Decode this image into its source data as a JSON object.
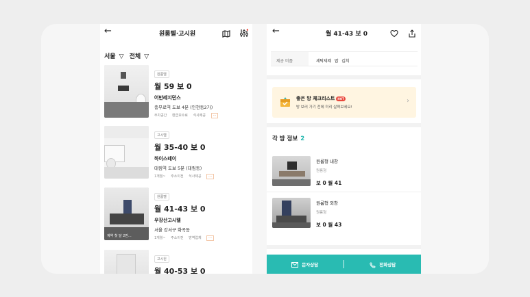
{
  "left": {
    "title": "원룸텔·고시원",
    "filters": {
      "region": "서울",
      "type": "전체"
    },
    "listings": [
      {
        "badge": "원룸텔",
        "price": "월 59  보 0",
        "name": "어반레지던스",
        "location": "충무로역 도보 4분 (인현동2가)",
        "tags": [
          "주차공간",
          "환급보수료",
          "식사제공"
        ],
        "overlay": ""
      },
      {
        "badge": "고시텔",
        "price": "월 35-40  보 0",
        "name": "하이스테이",
        "location": "대림역 도보 5분 (대림동)",
        "tags": [
          "1개월~",
          "주소이전",
          "식사제공"
        ],
        "overlay": ""
      },
      {
        "badge": "원룸텔",
        "price": "월 41-43  보 0",
        "name": "우장산고시텔",
        "location": "서울 강서구 화곡동",
        "tags": [
          "1개월~",
          "주소이전",
          "방역업체"
        ],
        "overlay": "계약 첫 달 2만..."
      },
      {
        "badge": "고시원",
        "price": "월 40-53  보 0",
        "name": "",
        "location": "",
        "tags": [],
        "overlay": ""
      }
    ]
  },
  "right": {
    "title": "월 41-43  보 0",
    "provide": {
      "label": "제공 비품",
      "items": "세탁세제  밥  김치"
    },
    "checklist": {
      "title": "좋은 방 체크리스트",
      "hot": "HOT",
      "subtitle": "방 보러 가기 전에 미리 살펴보세요!"
    },
    "rooms_header": {
      "label": "각 방 정보",
      "count": "2"
    },
    "rooms": [
      {
        "title": "원룸형 내창",
        "subtitle": "원룸형",
        "price": "보 0 월 41"
      },
      {
        "title": "원룸형 외창",
        "subtitle": "원룸형",
        "price": "보 0 월 43"
      }
    ],
    "bottom": {
      "sms": "문자상담",
      "call": "전화상담"
    }
  },
  "colors": {
    "accent": "#29bbb2",
    "hot": "#e9473b",
    "checklist_bg": "#fff5e1"
  }
}
